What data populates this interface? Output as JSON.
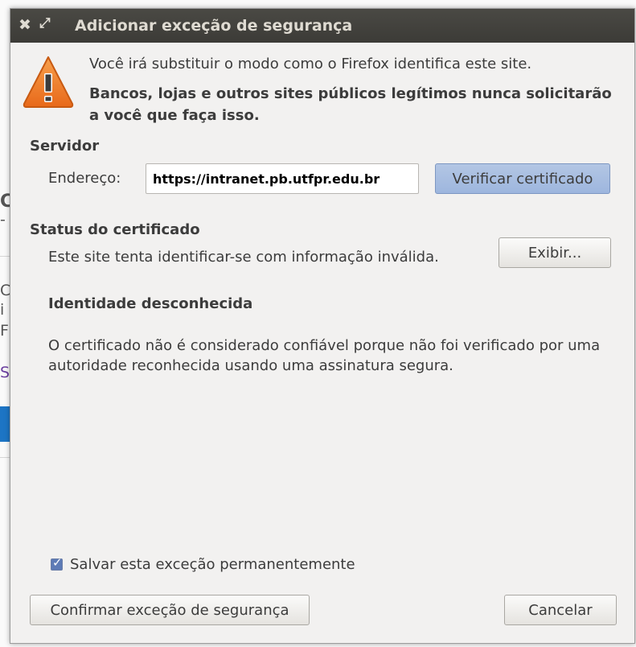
{
  "background": {
    "fragments": [
      "C",
      "-",
      "C",
      "i",
      "F",
      "S"
    ]
  },
  "dialog": {
    "title": "Adicionar exceção de segurança",
    "close_glyph": "✖",
    "maximize_glyph": "⤢",
    "warning_line": "Você irá substituir o modo como o Firefox identifica este site.",
    "warning_bold": "Bancos, lojas e outros sites públicos legítimos nunca solicitarão a você que faça isso.",
    "server_heading": "Servidor",
    "address_label": "Endereço:",
    "address_value": "https://intranet.pb.utfpr.edu.br",
    "verify_button": "Verificar certificado",
    "status_heading": "Status do certificado",
    "status_text": "Este site tenta identificar-se com informação inválida.",
    "view_button": "Exibir...",
    "identity_heading": "Identidade desconhecida",
    "cert_description": "O certificado não é considerado confiável porque não foi verificado por uma autoridade reconhecida usando uma assinatura segura.",
    "save_checkbox_label": "Salvar esta exceção permanentemente",
    "save_checked": true,
    "confirm_button": "Confirmar exceção de segurança",
    "cancel_button": "Cancelar"
  },
  "colors": {
    "titlebar": "#3c3b37",
    "dialog_bg": "#f2f1f0",
    "warning_orange": "#f07e29",
    "verify_highlight": "#a9bde1"
  },
  "icons": {
    "warning": "warning-triangle-icon",
    "close": "close-icon",
    "maximize": "maximize-icon"
  }
}
